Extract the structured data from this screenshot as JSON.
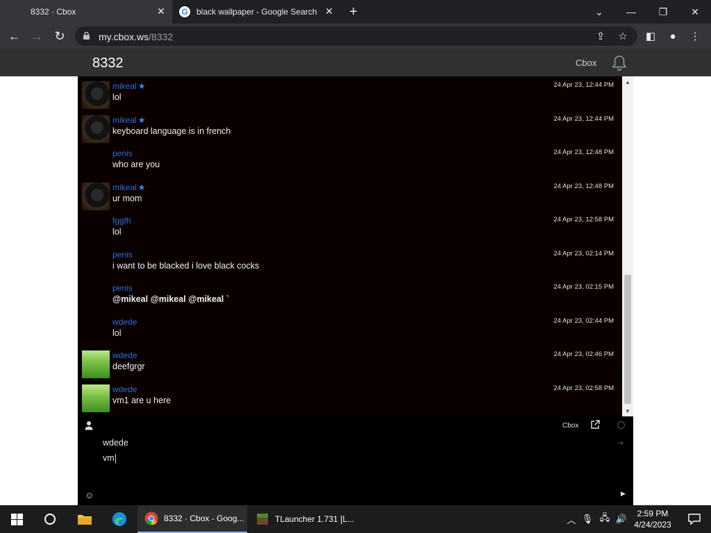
{
  "browser": {
    "tabs": [
      {
        "title": "8332 · Cbox",
        "active": true
      },
      {
        "title": "black wallpaper - Google Search",
        "active": false
      }
    ],
    "url_host": "my.cbox.ws",
    "url_path": "/8332"
  },
  "header": {
    "title": "8332",
    "cbox_link": "Cbox"
  },
  "messages": [
    {
      "author": "mikeal",
      "starred": true,
      "text": "lol",
      "time": "24 Apr 23, 12:44 PM",
      "avatar": "dark",
      "bold": false
    },
    {
      "author": "mikeal",
      "starred": true,
      "text": "keyboard language is in french",
      "time": "24 Apr 23, 12:44 PM",
      "avatar": "dark",
      "bold": false
    },
    {
      "author": "penis",
      "starred": false,
      "text": "who are you",
      "time": "24 Apr 23, 12:48 PM",
      "avatar": "none",
      "bold": false
    },
    {
      "author": "mikeal",
      "starred": true,
      "text": "ur mom",
      "time": "24 Apr 23, 12:48 PM",
      "avatar": "dark",
      "bold": false
    },
    {
      "author": "fggfh",
      "starred": false,
      "text": "lol",
      "time": "24 Apr 23, 12:58 PM",
      "avatar": "none",
      "bold": false
    },
    {
      "author": "penis",
      "starred": false,
      "text": "i want to be blacked i love black cocks",
      "time": "24 Apr 23, 02:14 PM",
      "avatar": "none",
      "bold": false
    },
    {
      "author": "penis",
      "starred": false,
      "text": "@mikeal @mikeal @mikeal `",
      "time": "24 Apr 23, 02:15 PM",
      "avatar": "none",
      "bold": true
    },
    {
      "author": "wdede",
      "starred": false,
      "text": "lol",
      "time": "24 Apr 23, 02:44 PM",
      "avatar": "none",
      "bold": false
    },
    {
      "author": "wdede",
      "starred": false,
      "text": "deefgrgr",
      "time": "24 Apr 23, 02:46 PM",
      "avatar": "grass",
      "bold": false
    },
    {
      "author": "wdede",
      "starred": false,
      "text": "vm1 are u here",
      "time": "24 Apr 23, 02:58 PM",
      "avatar": "grass",
      "bold": false
    }
  ],
  "footer": {
    "cbox_label": "Cbox"
  },
  "composer": {
    "name_value": "wdede",
    "message_value": "vm"
  },
  "taskbar": {
    "tasks": [
      {
        "label": "8332 · Cbox - Goog...",
        "active": true
      },
      {
        "label": "TLauncher 1.731 [L...",
        "active": false
      }
    ],
    "time": "2:59 PM",
    "date": "4/24/2023"
  },
  "colors": {
    "author_blue": "#2f6fd6",
    "chat_bg": "#0a0000",
    "header_bg": "#303030"
  }
}
